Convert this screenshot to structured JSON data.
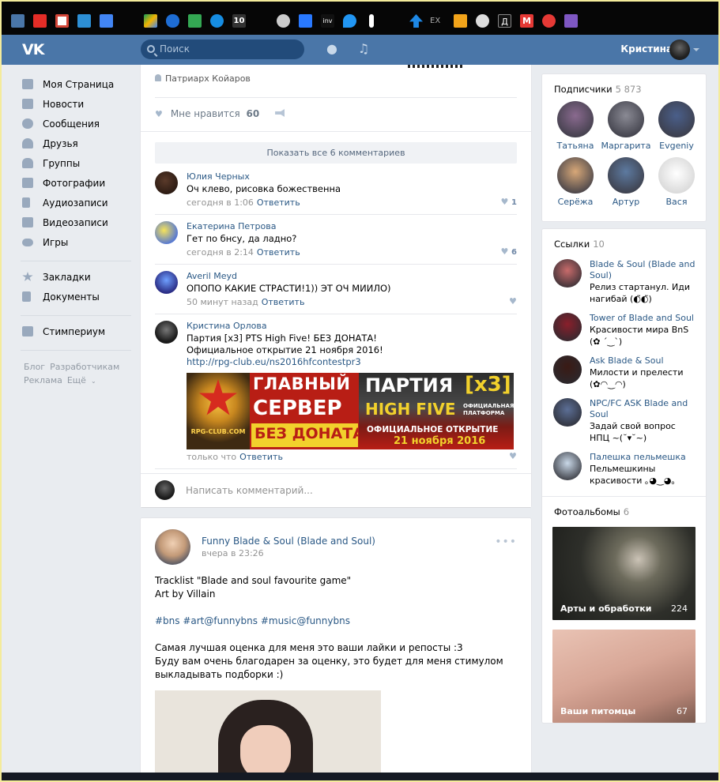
{
  "browser": {
    "icons": [
      "vk-icon",
      "youtube-icon",
      "gmail-icon",
      "pin-icon",
      "translate-icon",
      "drive-icon",
      "onedrive-icon",
      "maps-icon",
      "mail-icon",
      "ten-icon",
      "clock-icon",
      "info-icon",
      "inv-icon",
      "drop-icon",
      "thermometer-icon",
      "up-arrow-icon",
      "ex-icon",
      "lock-icon",
      "play-icon",
      "d-icon",
      "m-icon",
      "plus-icon",
      "heart-icon"
    ],
    "ten_label": "10",
    "inv_label": "inv",
    "ex_label": "EX",
    "d_label": "Д",
    "m_label": "M"
  },
  "header": {
    "search_placeholder": "Поиск",
    "user_name": "Кристина"
  },
  "nav": {
    "items": [
      "Моя Страница",
      "Новости",
      "Сообщения",
      "Друзья",
      "Группы",
      "Фотографии",
      "Аудиозаписи",
      "Видеозаписи",
      "Игры"
    ],
    "items2": [
      "Закладки",
      "Документы"
    ],
    "items3": [
      "Стимпериум"
    ],
    "footer": [
      "Блог",
      "Разработчикам",
      "Реклама",
      "Ещё"
    ]
  },
  "post1": {
    "author_line": "Патриарх Койаров",
    "like_label": "Мне нравится",
    "like_count": "60",
    "show_all_comments": "Показать все 6 комментариев",
    "comments": [
      {
        "name": "Юлия Черных",
        "text": "Оч клево, рисовка божественна",
        "time": "сегодня в 1:06",
        "reply": "Ответить",
        "likes": "1"
      },
      {
        "name": "Екатерина Петрова",
        "text": "Гет по бнсу, да ладно?",
        "time": "сегодня в 2:14",
        "reply": "Ответить",
        "likes": "6"
      },
      {
        "name": "Averil Meyd",
        "text": "ОПОПО КАКИЕ СТРАСТИ!1)) ЭТ ОЧ МИИЛО)",
        "time": "50 минут назад",
        "reply": "Ответить",
        "likes": ""
      },
      {
        "name": "Кристина Орлова",
        "text_lines": [
          "Партия [x3] PTS High Five! БЕЗ ДОНАТА!",
          "Официальное открытие 21 ноября 2016!"
        ],
        "url": "http://rpg-club.eu/ns2016hfcontestpr3",
        "time": "только что",
        "reply": "Ответить",
        "likes": ""
      }
    ],
    "banner": {
      "left_logo": "RPG-CLUB.COM",
      "line1": "ГЛАВНЫЙ",
      "line2": "СЕРВЕР",
      "line3": "БЕЗ ДОНАТА",
      "party": "ПАРТИЯ",
      "x3": "[x3]",
      "high_five": "HIGH FIVE",
      "platform": "ОФИЦИАЛЬНАЯ ПЛАТФОРМА",
      "opening": "ОФИЦИАЛЬНОЕ ОТКРЫТИЕ",
      "date": "21 ноября 2016"
    },
    "write_comment_placeholder": "Написать комментарий..."
  },
  "post2": {
    "group": "Funny Blade & Soul (Blade and Soul)",
    "time": "вчера в 23:26",
    "lines": [
      "Tracklist \"Blade and soul favourite game\"",
      "Art by Villain",
      "",
      "#bns #art@funnybns #music@funnybns",
      "",
      "Самая лучшая оценка для меня это ваши лайки и репосты :3",
      "Буду вам очень благодарен за оценку, это будет для меня стимулом выкладывать подборки :)"
    ]
  },
  "subscribers": {
    "title": "Подписчики",
    "count": "5 873",
    "people": [
      {
        "name": "Татьяна",
        "color": "#8a6a8f"
      },
      {
        "name": "Маргарита",
        "color": "#8a8a94"
      },
      {
        "name": "Evgeniy",
        "color": "#4a5f8a"
      },
      {
        "name": "Серёжа",
        "color": "#d8a878"
      },
      {
        "name": "Артур",
        "color": "#5d7aa0"
      },
      {
        "name": "Вася",
        "color": "#e6e6e6"
      }
    ]
  },
  "links": {
    "title": "Ссылки",
    "count": "10",
    "items": [
      {
        "title": "Blade & Soul (Blade and Soul)",
        "desc": "Релиз стартанул. Иди нагибай (◐̃◐̃)",
        "color": "#c86b6b"
      },
      {
        "title": "Tower of Blade and Soul",
        "desc": "Красивости мира BnS (✿ ´‿`)",
        "color": "#8a1f2b"
      },
      {
        "title": "Ask Blade & Soul",
        "desc": "Милости и прелести (✿◠‿◠)",
        "color": "#3a1a14"
      },
      {
        "title": "NPC/FC ASK Blade and Soul",
        "desc": "Задай свой вопрос НПЦ ~(˘▾˘~)",
        "color": "#5c6f96"
      },
      {
        "title": "Палешка пельмешка",
        "desc": "Пельмешкины красивости ｡◕‿◕｡",
        "color": "#c9d8e8"
      }
    ]
  },
  "albums": {
    "title": "Фотоальбомы",
    "count": "6",
    "items": [
      {
        "name": "Арты и обработки",
        "count": "224"
      },
      {
        "name": "Ваши питомцы",
        "count": "67"
      }
    ]
  }
}
